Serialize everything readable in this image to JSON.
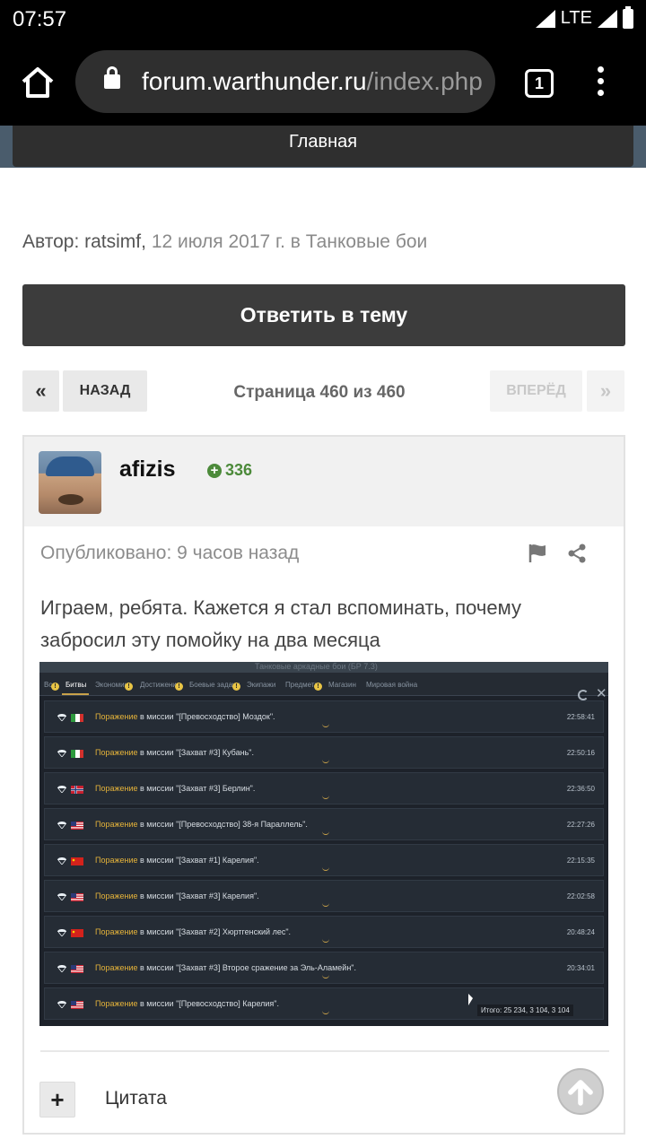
{
  "status_bar": {
    "time": "07:57",
    "network": "LTE"
  },
  "browser": {
    "url_domain": "forum.warthunder.ru",
    "url_path": "/index.php",
    "tab_count": "1"
  },
  "nav": {
    "home_label": "Главная"
  },
  "topic": {
    "author_prefix": "Автор:",
    "author": "ratsimf,",
    "date_section": "12 июля 2017 г. в Танковые бои",
    "reply_label": "Ответить в тему"
  },
  "pagination": {
    "first_icon": "«",
    "prev_label": "НАЗАД",
    "page_text": "Страница 460 из 460",
    "next_label": "ВПЕРЁД",
    "last_icon": "»"
  },
  "post": {
    "username": "afizis",
    "reputation": "336",
    "published": "Опубликовано: 9 часов назад",
    "text": "Играем, ребята. Кажется я стал вспоминать, почему забросил эту помойку на два месяца",
    "quote_label": "Цитата",
    "plus_label": "+"
  },
  "game_screenshot": {
    "window_title": "Танковые аркадные бои (БР 7.3)",
    "tabs": [
      "Все",
      "Битвы",
      "Экономика",
      "Достижения",
      "Боевые задачи",
      "Экипажи",
      "Предметы",
      "Магазин",
      "Мировая война"
    ],
    "selected_tab": "Битвы",
    "battles": [
      {
        "result": "Поражение",
        "mission": " в миссии \"[Превосходство] Моздок\".",
        "time": "22:58:41",
        "nation": "italy"
      },
      {
        "result": "Поражение",
        "mission": " в миссии \"[Захват #3] Кубань\".",
        "time": "22:50:16",
        "nation": "italy"
      },
      {
        "result": "Поражение",
        "mission": " в миссии \"[Захват #3] Берлин\".",
        "time": "22:36:50",
        "nation": "norway"
      },
      {
        "result": "Поражение",
        "mission": " в миссии \"[Превосходство] 38-я Параллель\".",
        "time": "22:27:26",
        "nation": "usa"
      },
      {
        "result": "Поражение",
        "mission": " в миссии \"[Захват #1] Карелия\".",
        "time": "22:15:35",
        "nation": "china"
      },
      {
        "result": "Поражение",
        "mission": " в миссии \"[Захват #3] Карелия\".",
        "time": "22:02:58",
        "nation": "usa"
      },
      {
        "result": "Поражение",
        "mission": " в миссии \"[Захват #2] Хюртгенский лес\".",
        "time": "20:48:24",
        "nation": "china"
      },
      {
        "result": "Поражение",
        "mission": " в миссии \"[Захват #3] Второе сражение за Эль-Аламейн\".",
        "time": "20:34:01",
        "nation": "usa"
      },
      {
        "result": "Поражение",
        "mission": " в миссии \"[Превосходство] Карелия\".",
        "time": "",
        "nation": "usa"
      }
    ],
    "total": "Итого: 25 234, 3 104, 3 104"
  },
  "colors": {
    "accent_reply": "#3c3c3c",
    "reputation": "#4c8a3a",
    "loss": "#e6b43a"
  }
}
